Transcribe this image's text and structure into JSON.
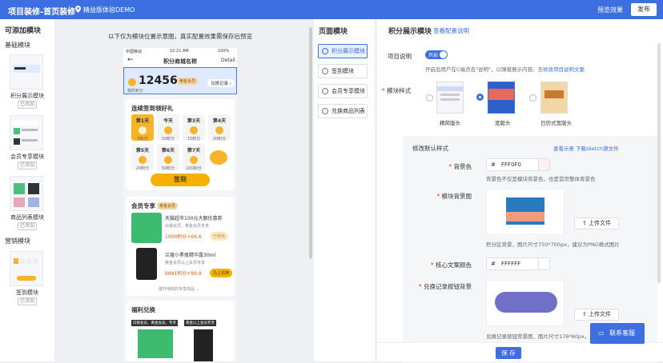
{
  "topbar": {
    "title": "项目装修-首页装修",
    "store": "精益版体验DEMO",
    "preview": "预览效果",
    "publish": "发布"
  },
  "leftpane": {
    "heading": "可添加模块",
    "group_basic": "基础模块",
    "group_marketing": "营销模块",
    "tiles": [
      {
        "label": "积分展示模块",
        "status": "已添加"
      },
      {
        "label": "会员专享模块",
        "status": "已添加"
      },
      {
        "label": "商品列表模块",
        "status": "已添加"
      },
      {
        "label": "签到模块",
        "status": "已添加"
      }
    ]
  },
  "preview": {
    "hint": "以下仅为模块位置示意图，真实配置效果需保存后预览",
    "status_left": "中国移动",
    "status_time": "10:21 AM",
    "status_right": "100%",
    "nav_title": "积分商城名称",
    "nav_detail": "Detail",
    "points": "12456",
    "points_badge": "黄金会员",
    "my_points": "我的积分",
    "exchange_record": "兑换记录",
    "signin_title": "连续签到领好礼",
    "days": [
      {
        "d": "第1天",
        "p": "5积分"
      },
      {
        "d": "今天",
        "p": "10积分"
      },
      {
        "d": "第3天",
        "p": "15积分"
      },
      {
        "d": "第4天",
        "p": "20积分"
      },
      {
        "d": "第5天",
        "p": "20积分"
      },
      {
        "d": "第6天",
        "p": "50积分"
      },
      {
        "d": "第7天",
        "p": "100积分"
      }
    ],
    "signin_btn": "签到",
    "member_title": "会员专享",
    "member_badge": "黄金会员",
    "products": [
      {
        "name": "天猫超市100元大额优惠券",
        "sub": "白银会员、黄金会员专享",
        "price": "1000积分+66.6",
        "btn": "已抢完"
      },
      {
        "name": "兰蔻小黑瓶精华露30ml",
        "sub": "黄金会员以上会员专享",
        "price": "9991积分+99.9",
        "btn": "马上兑换"
      }
    ],
    "more": "展开待购的专享商品",
    "welfare_title": "福利兑换",
    "welfare_tags": [
      "白银会员、黄金会员、专享",
      "黄金以上会员专享"
    ]
  },
  "midpane": {
    "heading": "页面模块",
    "items": [
      "积分展示模块",
      "签到模块",
      "会员专享模块",
      "兑换商品列表"
    ]
  },
  "rightpane": {
    "heading": "积分展示模块",
    "config_link": "查看配置说明",
    "desc_label": "项目说明",
    "toggle": "开启",
    "desc_help": "开启后用户在C端点击\"说明\"，以弹窗展示内容。",
    "desc_link": "去修改项目说明文案",
    "style_label": "模块样式",
    "styles": [
      "精简版头",
      "宽版头",
      "日历式宽版头"
    ],
    "style_selected": 1,
    "default_title": "修改默认样式",
    "view_example": "查看示意",
    "download_sketch": "下载sketch源文件",
    "bgcolor_label": "背景色",
    "bgcolor_value": "FFF0F0",
    "bgcolor_swatch": "#fff0f0",
    "bgcolor_help": "背景色不仅是模块背景色，也是首页整体背景色",
    "bgimg_label": "模块背景图",
    "upload": "上传文件",
    "bgimg_help": "积分区背景，图片尺寸750*700px，建议为PNG格式图片",
    "core_color_label": "核心文案颜色",
    "core_color_value": "FFFFFF",
    "btn_bg_label": "兑换记录按钮背景",
    "btn_bg_help": "兑换记录按钮背景图，图片尺寸176*60px，建议",
    "save": "保 存",
    "service": "联系客服"
  },
  "colors": {
    "accent": "#3d6fe0",
    "gold": "#f7b32b",
    "btn_swatch": "#7070c8"
  }
}
